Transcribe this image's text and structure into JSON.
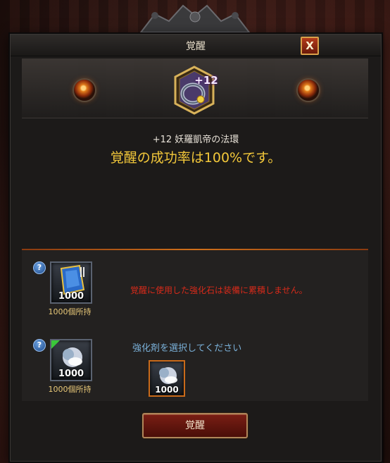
{
  "dialog": {
    "title": "覚醒",
    "close_label": "X",
    "item": {
      "level": "+12",
      "name": "+12 妖羅凱帝の法環"
    },
    "success_message": "覚醒の成功率は100%です。",
    "materials": {
      "help_label": "?",
      "stone": {
        "count": "1000",
        "owned": "1000個所持"
      },
      "enhancer": {
        "count": "1000",
        "owned": "1000個所持"
      },
      "selected": {
        "count": "1000"
      },
      "warning": "覚醒に使用した強化石は装備に累積しません。",
      "select_prompt": "強化剤を選択してください"
    },
    "awaken_button": "覚醒"
  },
  "colors": {
    "accent_gold": "#f3c83a",
    "warning_red": "#d72a1a",
    "prompt_blue": "#7ab0d8"
  }
}
